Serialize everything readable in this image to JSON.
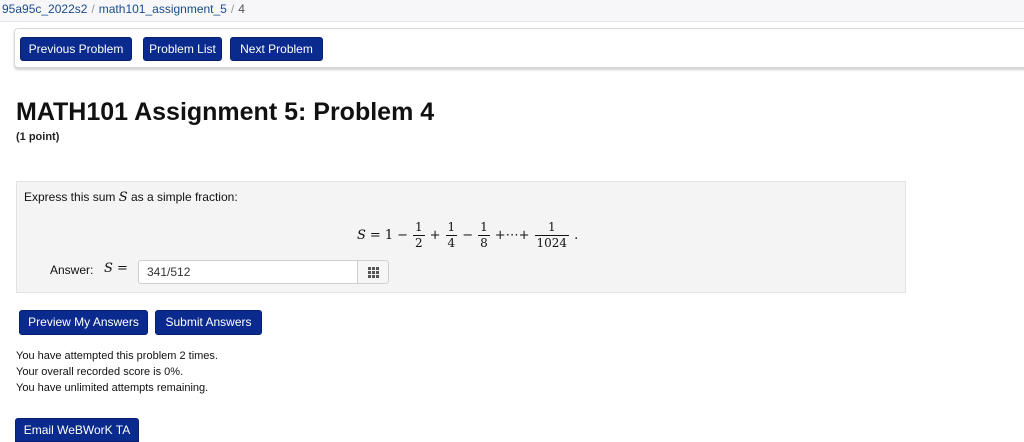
{
  "breadcrumb": {
    "course": "95a95c_2022s2",
    "sep1": "/",
    "set": "math101_assignment_5",
    "sep2": "/",
    "problem": "4"
  },
  "nav": {
    "previous_label": "Previous Problem",
    "list_label": "Problem List",
    "next_label": "Next Problem"
  },
  "problem": {
    "title": "MATH101 Assignment 5: Problem 4",
    "points": "(1 point)",
    "prompt_before": "Express this sum ",
    "prompt_var": "S",
    "prompt_after": " as a simple fraction:",
    "formula": {
      "lhs": "S",
      "eq": "=",
      "one": "1",
      "minus1": "−",
      "frac1_num": "1",
      "frac1_den": "2",
      "plus1": "+",
      "frac2_num": "1",
      "frac2_den": "4",
      "minus2": "−",
      "frac3_num": "1",
      "frac3_den": "8",
      "plus_dots": "+⋯+",
      "frac4_num": "1",
      "frac4_den": "1024",
      "period": "."
    }
  },
  "answer": {
    "label": "Answer:",
    "var": "S =",
    "value": "341/512"
  },
  "actions": {
    "preview_label": "Preview My Answers",
    "submit_label": "Submit Answers"
  },
  "status": {
    "attempts": "You have attempted this problem 2 times.",
    "score": "Your overall recorded score is 0%.",
    "remaining": "You have unlimited attempts remaining."
  },
  "footer": {
    "email_label": "Email WeBWorK TA"
  },
  "colors": {
    "button_bg": "#0b2a8e",
    "problem_bg": "#f4f4f4"
  },
  "icons": {
    "keypad": "grid-icon"
  }
}
